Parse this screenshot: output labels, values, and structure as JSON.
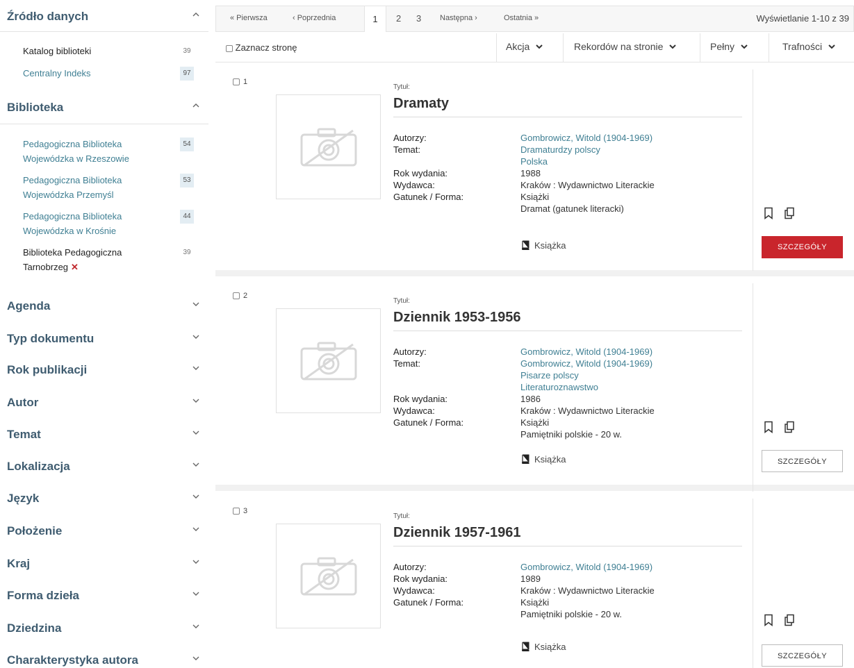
{
  "sidebar": {
    "facets": [
      {
        "title": "Źródło danych",
        "expanded": true,
        "items": [
          {
            "label": "Katalog biblioteki",
            "count": "39",
            "active": true
          },
          {
            "label": "Centralny Indeks",
            "count": "97",
            "active": false
          }
        ]
      },
      {
        "title": "Biblioteka",
        "expanded": true,
        "items": [
          {
            "label": "Pedagogiczna Biblioteka Wojewódzka w Rzeszowie",
            "count": "54",
            "active": false
          },
          {
            "label": "Pedagogiczna Biblioteka Wojewódzka Przemyśl",
            "count": "53",
            "active": false
          },
          {
            "label": "Pedagogiczna Biblioteka Wojewódzka w Krośnie",
            "count": "44",
            "active": false
          },
          {
            "label": "Biblioteka Pedagogiczna Tarnobrzeg",
            "count": "39",
            "active": true,
            "remove": "✕"
          }
        ]
      },
      {
        "title": "Agenda",
        "expanded": false
      },
      {
        "title": "Typ dokumentu",
        "expanded": false
      },
      {
        "title": "Rok publikacji",
        "expanded": false
      },
      {
        "title": "Autor",
        "expanded": false
      },
      {
        "title": "Temat",
        "expanded": false
      },
      {
        "title": "Lokalizacja",
        "expanded": false
      },
      {
        "title": "Język",
        "expanded": false
      },
      {
        "title": "Położenie",
        "expanded": false
      },
      {
        "title": "Kraj",
        "expanded": false
      },
      {
        "title": "Forma dzieła",
        "expanded": false
      },
      {
        "title": "Dziedzina",
        "expanded": false
      },
      {
        "title": "Charakterystyka autora",
        "expanded": false
      }
    ]
  },
  "pager": {
    "first": "« Pierwsza",
    "prev": "‹ Poprzednia",
    "pages": [
      "1",
      "2",
      "3"
    ],
    "current": "1",
    "next": "Następna ›",
    "last": "Ostatnia »",
    "counter": "Wyświetlanie 1-10 z 39"
  },
  "toolbar": {
    "select_page": "Zaznacz stronę",
    "action": "Akcja",
    "per_page": "Rekordów na stronie",
    "view": "Pełny",
    "sort": "Trafności"
  },
  "colors": {
    "accent": "#c9252c",
    "link": "#3f7f93",
    "facet_title": "#3f5c70"
  },
  "records": [
    {
      "num": "1",
      "title_label": "Tytuł:",
      "title": "Dramaty",
      "fields": [
        {
          "key": "Autorzy:",
          "values": [
            "Gombrowicz, Witold (1904-1969)"
          ],
          "link": true
        },
        {
          "key": "Temat:",
          "values": [
            "Dramaturdzy polscy",
            "Polska"
          ],
          "link": true
        },
        {
          "key": "Rok wydania:",
          "values": [
            "1988"
          ],
          "link": false
        },
        {
          "key": "Wydawca:",
          "values": [
            "Kraków : Wydawnictwo Literackie"
          ],
          "link": false
        },
        {
          "key": "Gatunek / Forma:",
          "values": [
            "Książki",
            "Dramat (gatunek literacki)"
          ],
          "link": false
        }
      ],
      "format": "Książka",
      "button": "SZCZEGÓŁY",
      "button_primary": true
    },
    {
      "num": "2",
      "title_label": "Tytuł:",
      "title": "Dziennik 1953-1956",
      "fields": [
        {
          "key": "Autorzy:",
          "values": [
            "Gombrowicz, Witold (1904-1969)"
          ],
          "link": true
        },
        {
          "key": "Temat:",
          "values": [
            "Gombrowicz, Witold (1904-1969)",
            "Pisarze polscy",
            "Literaturoznawstwo"
          ],
          "link": true
        },
        {
          "key": "Rok wydania:",
          "values": [
            "1986"
          ],
          "link": false
        },
        {
          "key": "Wydawca:",
          "values": [
            "Kraków : Wydawnictwo Literackie"
          ],
          "link": false
        },
        {
          "key": "Gatunek / Forma:",
          "values": [
            "Książki",
            "Pamiętniki polskie - 20 w."
          ],
          "link": false
        }
      ],
      "format": "Książka",
      "button": "SZCZEGÓŁY",
      "button_primary": false
    },
    {
      "num": "3",
      "title_label": "Tytuł:",
      "title": "Dziennik 1957-1961",
      "fields": [
        {
          "key": "Autorzy:",
          "values": [
            "Gombrowicz, Witold (1904-1969)"
          ],
          "link": true
        },
        {
          "key": "Rok wydania:",
          "values": [
            "1989"
          ],
          "link": false
        },
        {
          "key": "Wydawca:",
          "values": [
            "Kraków : Wydawnictwo Literackie"
          ],
          "link": false
        },
        {
          "key": "Gatunek / Forma:",
          "values": [
            "Książki",
            "Pamiętniki polskie - 20 w."
          ],
          "link": false
        }
      ],
      "format": "Książka",
      "button": "SZCZEGÓŁY",
      "button_primary": false
    }
  ]
}
